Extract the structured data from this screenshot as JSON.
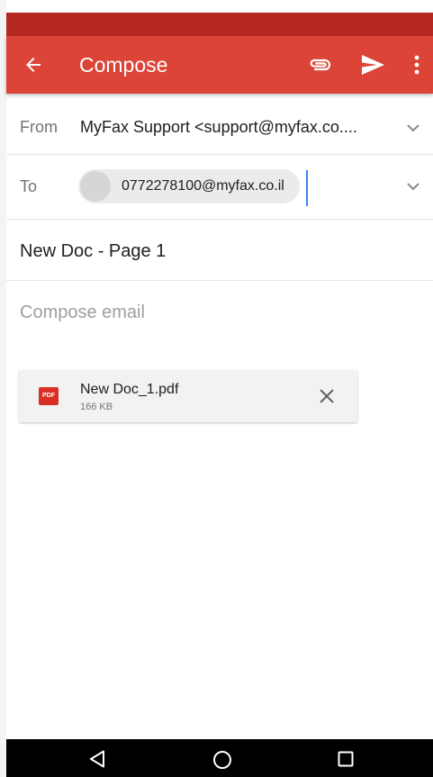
{
  "app_bar": {
    "title": "Compose",
    "icons": [
      "back-arrow-icon",
      "paperclip-icon",
      "send-icon",
      "more-vert-icon"
    ],
    "color": "#db4437",
    "status_color": "#b5281f"
  },
  "from": {
    "label": "From",
    "value": "MyFax Support <support@myfax.co...."
  },
  "to": {
    "label": "To",
    "recipient": "0772278100@myfax.co.il"
  },
  "subject": {
    "value": "New Doc - Page 1"
  },
  "body": {
    "placeholder": "Compose email"
  },
  "attachment": {
    "badge": "PDF",
    "name": "New Doc_1.pdf",
    "size": "166 KB"
  },
  "nav": {
    "icons": [
      "nav-back-icon",
      "nav-home-icon",
      "nav-recents-icon"
    ]
  },
  "colors": {
    "accent": "#db4437",
    "cursor": "#4285f4",
    "pdf": "#d93025"
  }
}
